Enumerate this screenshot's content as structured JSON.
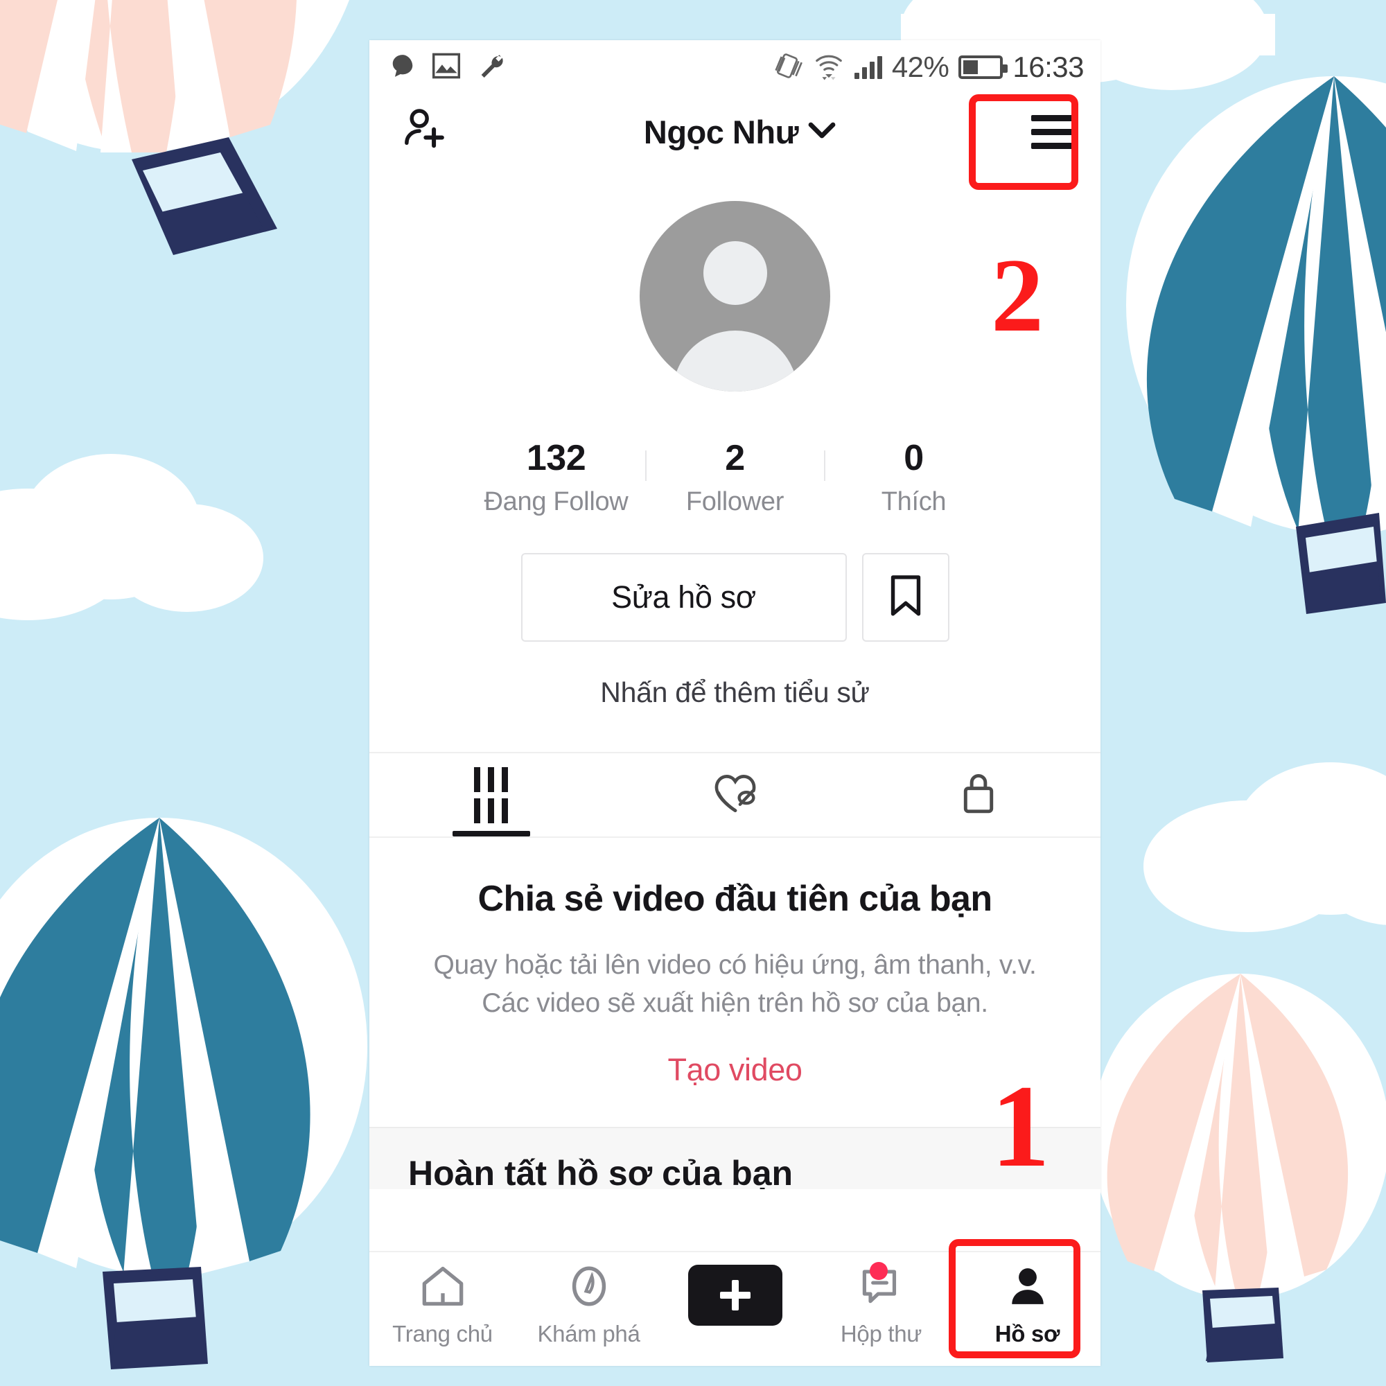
{
  "background": {
    "sky_color": "#cdecf7",
    "cloud_color": "#ffffff",
    "balloon_pink": "#fcdcd2",
    "balloon_teal": "#2e7d9e",
    "basket_navy": "#29325f",
    "description": "light blue sky with white clouds and striped hot air balloons"
  },
  "status_bar": {
    "icons_left": [
      "chat-bubble-icon",
      "image-icon",
      "wrench-icon"
    ],
    "icons_right": [
      "rotation-lock-icon",
      "wifi-icon",
      "signal-bars-icon",
      "battery-icon"
    ],
    "battery_percent": "42%",
    "battery_level": 42,
    "time": "16:33"
  },
  "header": {
    "add_friend_icon": "add-person-icon",
    "username": "Ngọc Như",
    "dropdown_icon": "chevron-down-icon",
    "menu_icon": "hamburger-menu-icon"
  },
  "profile": {
    "avatar_icon": "default-avatar-icon",
    "stats": [
      {
        "value": "132",
        "label": "Đang Follow"
      },
      {
        "value": "2",
        "label": "Follower"
      },
      {
        "value": "0",
        "label": "Thích"
      }
    ],
    "edit_button": "Sửa hồ sơ",
    "bookmark_icon": "bookmark-icon",
    "bio_placeholder": "Nhấn để thêm tiểu sử"
  },
  "content_tabs": [
    {
      "icon": "grid-icon",
      "active": true
    },
    {
      "icon": "hidden-liked-icon",
      "active": false
    },
    {
      "icon": "lock-icon",
      "active": false
    }
  ],
  "empty_state": {
    "title": "Chia sẻ video đầu tiên của bạn",
    "description": "Quay hoặc tải lên video có hiệu ứng, âm thanh, v.v. Các video sẽ xuất hiện trên hồ sơ của bạn.",
    "cta": "Tạo video",
    "cta_color": "#e04a62",
    "partial_next_section": "Hoàn tất hồ sơ của bạn"
  },
  "bottom_nav": [
    {
      "icon": "home-icon",
      "label": "Trang chủ",
      "active": false,
      "badge": false
    },
    {
      "icon": "compass-icon",
      "label": "Khám phá",
      "active": false,
      "badge": false
    },
    {
      "icon": "create-plus-icon",
      "label": "",
      "active": false,
      "badge": false
    },
    {
      "icon": "inbox-message-icon",
      "label": "Hộp thư",
      "active": false,
      "badge": true
    },
    {
      "icon": "person-icon",
      "label": "Hồ sơ",
      "active": true,
      "badge": false
    }
  ],
  "annotations": {
    "color": "#fb1b1b",
    "step_1": "1",
    "step_2": "2",
    "step_1_target": "profile-tab-bottom-nav",
    "step_2_target": "hamburger-menu-button"
  }
}
